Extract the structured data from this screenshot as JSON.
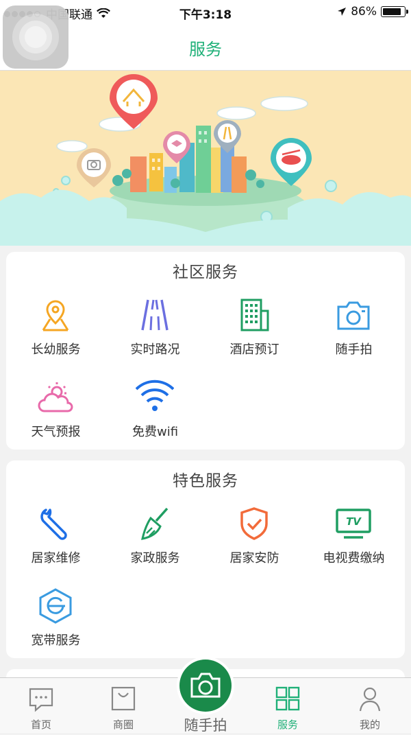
{
  "status_bar": {
    "carrier": "中国联通",
    "time": "下午3:18",
    "battery": "86%"
  },
  "nav": {
    "title": "服务"
  },
  "community": {
    "title": "社区服务",
    "items": [
      {
        "label": "长幼服务",
        "icon": "location-pin-map-icon"
      },
      {
        "label": "实时路况",
        "icon": "road-icon"
      },
      {
        "label": "酒店预订",
        "icon": "building-icon"
      },
      {
        "label": "随手拍",
        "icon": "camera-icon"
      },
      {
        "label": "天气预报",
        "icon": "weather-icon"
      },
      {
        "label": "免费wifi",
        "icon": "wifi-icon"
      }
    ]
  },
  "featured": {
    "title": "特色服务",
    "items": [
      {
        "label": "居家维修",
        "icon": "wrench-icon"
      },
      {
        "label": "家政服务",
        "icon": "broom-icon"
      },
      {
        "label": "居家安防",
        "icon": "shield-check-icon"
      },
      {
        "label": "电视费缴纳",
        "icon": "tv-icon"
      },
      {
        "label": "宽带服务",
        "icon": "broadband-icon"
      }
    ],
    "tv_text": "TV"
  },
  "tabbar": {
    "items": [
      {
        "label": "首页",
        "icon": "message-icon"
      },
      {
        "label": "商圈",
        "icon": "shopping-bag-icon"
      },
      {
        "label": "随手拍",
        "icon": "camera-icon"
      },
      {
        "label": "服务",
        "icon": "grid-icon",
        "active": true
      },
      {
        "label": "我的",
        "icon": "person-icon"
      }
    ]
  },
  "colors": {
    "accent": "#1fb078",
    "camera_button": "#1a8a4a",
    "banner_bg": "#fbe6b5"
  }
}
